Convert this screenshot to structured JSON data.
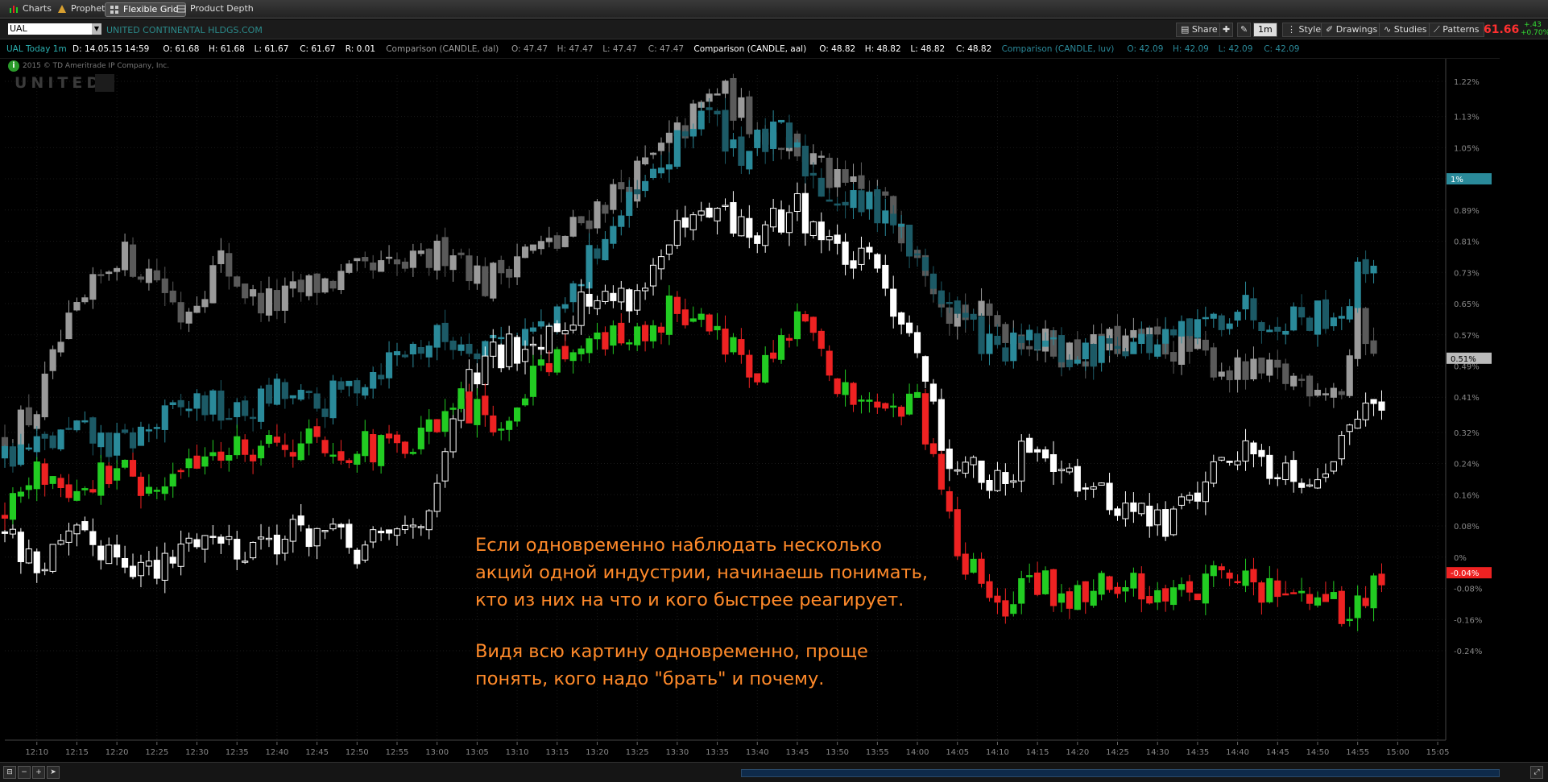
{
  "tabs": [
    {
      "label": "Charts",
      "active": false
    },
    {
      "label": "Prophet",
      "active": false
    },
    {
      "label": "Flexible Grid",
      "active": true
    },
    {
      "label": "Product Depth",
      "active": false
    }
  ],
  "header": {
    "symbol": "UAL",
    "company": "UNITED CONTINENTAL HLDGS.COM",
    "buttons": {
      "share": "Share",
      "timeframe": "1m",
      "style": "Style",
      "drawings": "Drawings",
      "studies": "Studies",
      "patterns": "Patterns"
    },
    "last_price": "61.66",
    "change_abs": "+.43",
    "change_pct": "+0.70%"
  },
  "legend": {
    "main": {
      "text": "UAL Today 1m",
      "color": "#2bb0b0"
    },
    "items": [
      {
        "text": "D: 14.05.15 14:59",
        "color": "#ffffff"
      },
      {
        "text": "O: 61.68",
        "color": "#ffffff"
      },
      {
        "text": "H: 61.68",
        "color": "#ffffff"
      },
      {
        "text": "L: 61.67",
        "color": "#ffffff"
      },
      {
        "text": "C: 61.67",
        "color": "#ffffff"
      },
      {
        "text": "R: 0.01",
        "color": "#ffffff"
      },
      {
        "text": "Comparison (CANDLE, dal)",
        "color": "#999999"
      },
      {
        "text": "O: 47.47",
        "color": "#999999"
      },
      {
        "text": "H: 47.47",
        "color": "#999999"
      },
      {
        "text": "L: 47.47",
        "color": "#999999"
      },
      {
        "text": "C: 47.47",
        "color": "#999999"
      },
      {
        "text": "Comparison (CANDLE, aal)",
        "color": "#ffffff"
      },
      {
        "text": "O: 48.82",
        "color": "#ffffff"
      },
      {
        "text": "H: 48.82",
        "color": "#ffffff"
      },
      {
        "text": "L: 48.82",
        "color": "#ffffff"
      },
      {
        "text": "C: 48.82",
        "color": "#ffffff"
      },
      {
        "text": "Comparison (CANDLE, luv)",
        "color": "#2b8a9a"
      },
      {
        "text": "O: 42.09",
        "color": "#2b8a9a"
      },
      {
        "text": "H: 42.09",
        "color": "#2b8a9a"
      },
      {
        "text": "L: 42.09",
        "color": "#2b8a9a"
      },
      {
        "text": "C: 42.09",
        "color": "#2b8a9a"
      }
    ]
  },
  "copyright": "2015 © TD Ameritrade IP Company, Inc.",
  "watermark": "UNITED",
  "annotation": {
    "para1": [
      "Если одновременно наблюдать несколько",
      "акций одной индустрии, начинаешь понимать,",
      "кто из них на что и кого быстрее реагирует."
    ],
    "para2": [
      "Видя всю картину одновременно, проще",
      "понять, кого надо \"брать\" и почему."
    ]
  },
  "chart_data": {
    "type": "candlestick",
    "y_unit": "percent change",
    "ylim": [
      -0.27,
      1.25
    ],
    "y_ticks": [
      "1.22%",
      "1.13%",
      "1.05%",
      "0.97%",
      "0.89%",
      "0.81%",
      "0.73%",
      "0.65%",
      "0.57%",
      "0.49%",
      "0.41%",
      "0.32%",
      "0.24%",
      "0.16%",
      "0.08%",
      "0%",
      "-0.08%",
      "-0.16%",
      "-0.24%"
    ],
    "y_tick_values": [
      1.22,
      1.13,
      1.05,
      0.97,
      0.89,
      0.81,
      0.73,
      0.65,
      0.57,
      0.49,
      0.41,
      0.32,
      0.24,
      0.16,
      0.08,
      0,
      -0.08,
      -0.16,
      -0.24
    ],
    "x_ticks": [
      "12:10",
      "12:15",
      "12:20",
      "12:25",
      "12:30",
      "12:35",
      "12:40",
      "12:45",
      "12:50",
      "12:55",
      "13:00",
      "13:05",
      "13:10",
      "13:15",
      "13:20",
      "13:25",
      "13:30",
      "13:35",
      "13:40",
      "13:45",
      "13:50",
      "13:55",
      "14:00",
      "14:05",
      "14:10",
      "14:15",
      "14:20",
      "14:25",
      "14:30",
      "14:35",
      "14:40",
      "14:45",
      "14:50",
      "14:55",
      "15:00",
      "15:05"
    ],
    "x_range": [
      "12:06",
      "15:06"
    ],
    "series": [
      {
        "name": "dal",
        "up_color": "#9a9a9a",
        "down_color": "#5a5a5a",
        "keypoints": [
          [
            "12:06",
            0.3
          ],
          [
            "12:10",
            0.38
          ],
          [
            "12:13",
            0.55
          ],
          [
            "12:17",
            0.68
          ],
          [
            "12:20",
            0.78
          ],
          [
            "12:25",
            0.72
          ],
          [
            "12:28",
            0.62
          ],
          [
            "12:33",
            0.76
          ],
          [
            "12:37",
            0.66
          ],
          [
            "12:40",
            0.65
          ],
          [
            "12:45",
            0.7
          ],
          [
            "12:52",
            0.73
          ],
          [
            "12:58",
            0.75
          ],
          [
            "13:02",
            0.8
          ],
          [
            "13:06",
            0.7
          ],
          [
            "13:10",
            0.78
          ],
          [
            "13:15",
            0.8
          ],
          [
            "13:20",
            0.9
          ],
          [
            "13:25",
            0.98
          ],
          [
            "13:30",
            1.08
          ],
          [
            "13:35",
            1.2
          ],
          [
            "13:40",
            1.1
          ],
          [
            "13:45",
            1.05
          ],
          [
            "13:50",
            0.95
          ],
          [
            "13:55",
            0.92
          ],
          [
            "14:00",
            0.8
          ],
          [
            "14:04",
            0.64
          ],
          [
            "14:10",
            0.6
          ],
          [
            "14:15",
            0.55
          ],
          [
            "14:20",
            0.52
          ],
          [
            "14:25",
            0.55
          ],
          [
            "14:30",
            0.55
          ],
          [
            "14:35",
            0.52
          ],
          [
            "14:40",
            0.47
          ],
          [
            "14:45",
            0.46
          ],
          [
            "14:50",
            0.45
          ],
          [
            "14:53",
            0.43
          ],
          [
            "14:55",
            0.6
          ],
          [
            "14:57",
            0.55
          ]
        ]
      },
      {
        "name": "aal",
        "up_color": "#ffffff",
        "down_color": "#ffffff",
        "keypoints": [
          [
            "12:06",
            0.06
          ],
          [
            "12:10",
            -0.02
          ],
          [
            "12:15",
            0.04
          ],
          [
            "12:20",
            0.02
          ],
          [
            "12:25",
            -0.05
          ],
          [
            "12:30",
            0.06
          ],
          [
            "12:35",
            0.03
          ],
          [
            "12:40",
            0.05
          ],
          [
            "12:45",
            0.07
          ],
          [
            "12:50",
            0.01
          ],
          [
            "12:55",
            0.06
          ],
          [
            "13:00",
            0.15
          ],
          [
            "13:03",
            0.42
          ],
          [
            "13:07",
            0.51
          ],
          [
            "13:12",
            0.56
          ],
          [
            "13:18",
            0.65
          ],
          [
            "13:25",
            0.68
          ],
          [
            "13:30",
            0.82
          ],
          [
            "13:35",
            0.88
          ],
          [
            "13:40",
            0.82
          ],
          [
            "13:45",
            0.9
          ],
          [
            "13:50",
            0.78
          ],
          [
            "13:55",
            0.73
          ],
          [
            "14:00",
            0.55
          ],
          [
            "14:03",
            0.28
          ],
          [
            "14:07",
            0.22
          ],
          [
            "14:11",
            0.17
          ],
          [
            "14:14",
            0.3
          ],
          [
            "14:18",
            0.25
          ],
          [
            "14:22",
            0.16
          ],
          [
            "14:27",
            0.12
          ],
          [
            "14:31",
            0.08
          ],
          [
            "14:35",
            0.18
          ],
          [
            "14:40",
            0.28
          ],
          [
            "14:44",
            0.24
          ],
          [
            "14:49",
            0.21
          ],
          [
            "14:53",
            0.28
          ],
          [
            "14:56",
            0.43
          ],
          [
            "14:58",
            0.42
          ]
        ]
      },
      {
        "name": "luv",
        "up_color": "#2a8a9a",
        "down_color": "#1c5a66",
        "keypoints": [
          [
            "12:06",
            0.26
          ],
          [
            "12:10",
            0.28
          ],
          [
            "12:15",
            0.32
          ],
          [
            "12:20",
            0.28
          ],
          [
            "12:25",
            0.34
          ],
          [
            "12:30",
            0.4
          ],
          [
            "12:35",
            0.36
          ],
          [
            "12:40",
            0.42
          ],
          [
            "12:45",
            0.38
          ],
          [
            "12:50",
            0.45
          ],
          [
            "12:55",
            0.52
          ],
          [
            "13:00",
            0.56
          ],
          [
            "13:05",
            0.55
          ],
          [
            "13:10",
            0.57
          ],
          [
            "13:15",
            0.6
          ],
          [
            "13:20",
            0.8
          ],
          [
            "13:25",
            0.92
          ],
          [
            "13:30",
            1.05
          ],
          [
            "13:33",
            1.15
          ],
          [
            "13:38",
            1.04
          ],
          [
            "13:43",
            1.08
          ],
          [
            "13:48",
            0.95
          ],
          [
            "13:52",
            0.9
          ],
          [
            "13:56",
            0.9
          ],
          [
            "14:00",
            0.75
          ],
          [
            "14:05",
            0.62
          ],
          [
            "14:10",
            0.52
          ],
          [
            "14:15",
            0.55
          ],
          [
            "14:20",
            0.5
          ],
          [
            "14:25",
            0.56
          ],
          [
            "14:30",
            0.54
          ],
          [
            "14:35",
            0.58
          ],
          [
            "14:40",
            0.65
          ],
          [
            "14:43",
            0.62
          ],
          [
            "14:48",
            0.62
          ],
          [
            "14:53",
            0.63
          ],
          [
            "14:55",
            0.72
          ],
          [
            "14:57",
            0.78
          ]
        ]
      },
      {
        "name": "UAL",
        "up_color": "#22cc22",
        "down_color": "#ee2222",
        "keypoints": [
          [
            "12:06",
            0.1
          ],
          [
            "12:10",
            0.22
          ],
          [
            "12:15",
            0.18
          ],
          [
            "12:20",
            0.22
          ],
          [
            "12:25",
            0.15
          ],
          [
            "12:30",
            0.26
          ],
          [
            "12:35",
            0.28
          ],
          [
            "12:40",
            0.3
          ],
          [
            "12:45",
            0.3
          ],
          [
            "12:50",
            0.28
          ],
          [
            "12:55",
            0.27
          ],
          [
            "13:00",
            0.32
          ],
          [
            "13:03",
            0.4
          ],
          [
            "13:07",
            0.32
          ],
          [
            "13:12",
            0.48
          ],
          [
            "13:16",
            0.54
          ],
          [
            "13:20",
            0.55
          ],
          [
            "13:25",
            0.56
          ],
          [
            "13:30",
            0.65
          ],
          [
            "13:33",
            0.62
          ],
          [
            "13:36",
            0.56
          ],
          [
            "13:40",
            0.45
          ],
          [
            "13:43",
            0.54
          ],
          [
            "13:46",
            0.62
          ],
          [
            "13:49",
            0.44
          ],
          [
            "13:53",
            0.41
          ],
          [
            "13:57",
            0.4
          ],
          [
            "14:00",
            0.4
          ],
          [
            "14:02",
            0.24
          ],
          [
            "14:05",
            0.03
          ],
          [
            "14:08",
            -0.07
          ],
          [
            "14:11",
            -0.16
          ],
          [
            "14:14",
            -0.06
          ],
          [
            "14:18",
            -0.1
          ],
          [
            "14:22",
            -0.08
          ],
          [
            "14:27",
            -0.07
          ],
          [
            "14:32",
            -0.1
          ],
          [
            "14:37",
            -0.05
          ],
          [
            "14:42",
            -0.07
          ],
          [
            "14:46",
            -0.1
          ],
          [
            "14:50",
            -0.13
          ],
          [
            "14:54",
            -0.14
          ],
          [
            "14:56",
            -0.09
          ],
          [
            "14:58",
            -0.04
          ]
        ]
      }
    ],
    "price_flags": [
      {
        "label": "1%",
        "value": 0.97,
        "color": "#2a8a9a"
      },
      {
        "label": "0.51%",
        "value": 0.51,
        "color": "#bbbbbb"
      },
      {
        "label": "-0.04%",
        "value": -0.04,
        "color": "#ee2222"
      }
    ]
  }
}
